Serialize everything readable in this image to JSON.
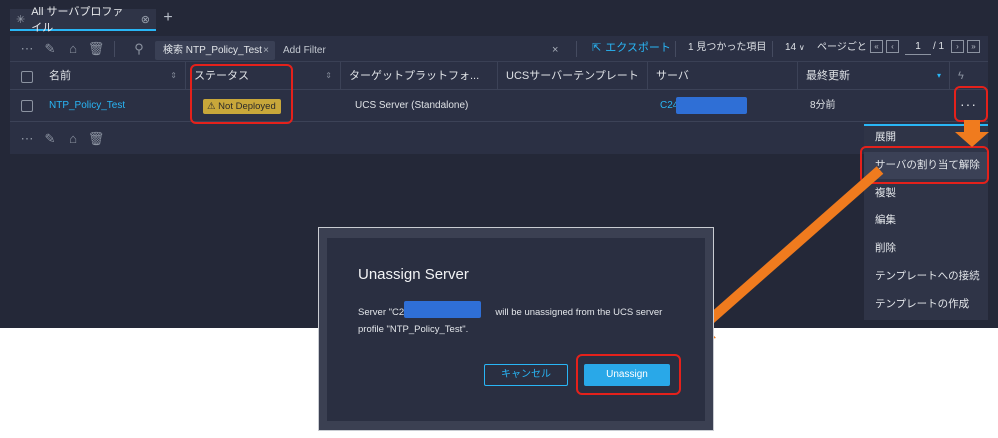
{
  "tab": {
    "icon": "asterisk-icon",
    "label": "All サーバプロファイル",
    "options_icon": "gear-icon",
    "add_icon": "plus-icon"
  },
  "toolbar": {
    "icons": [
      "more-icon",
      "edit-icon",
      "tag-icon",
      "trash-icon",
      "search-icon"
    ],
    "search_chip": "検索 NTP_Policy_Test",
    "search_chip_close": "×",
    "add_filter": "Add Filter",
    "clear": "×",
    "export_label": "エクスポート",
    "found_text": "1 見つかった項目",
    "per_page_value": "14",
    "per_page_label": "ページごと",
    "page_value": "1",
    "page_total": "/ 1"
  },
  "table": {
    "columns": [
      "名前",
      "ステータス",
      "ターゲットプラットフォ...",
      "UCSサーバーテンプレート",
      "サーバ",
      "最終更新"
    ],
    "row": {
      "name": "NTP_Policy_Test",
      "status": "Not Deployed",
      "target": "UCS Server (Standalone)",
      "template": "",
      "server_prefix": "C24",
      "updated": "8分前"
    },
    "footer_icons": [
      "more-icon",
      "edit-icon",
      "tag-icon",
      "trash-icon"
    ]
  },
  "context_menu": {
    "items": [
      "展開",
      "サーバの割り当て解除",
      "複製",
      "編集",
      "削除",
      "テンプレートへの接続",
      "テンプレートの作成"
    ],
    "highlighted_index": 1
  },
  "dialog": {
    "title": "Unassign Server",
    "body_prefix": "Server \"C24",
    "body_suffix": "will be unassigned from the UCS server",
    "body_line2": "profile \"NTP_Policy_Test\".",
    "cancel_label": "キャンセル",
    "confirm_label": "Unassign"
  },
  "colors": {
    "accent": "#29b6f6",
    "highlight_red": "#e4211b",
    "arrow_orange": "#f07b1e",
    "warning_badge": "#c8a73a",
    "redaction_blue": "#2f6fd6"
  }
}
